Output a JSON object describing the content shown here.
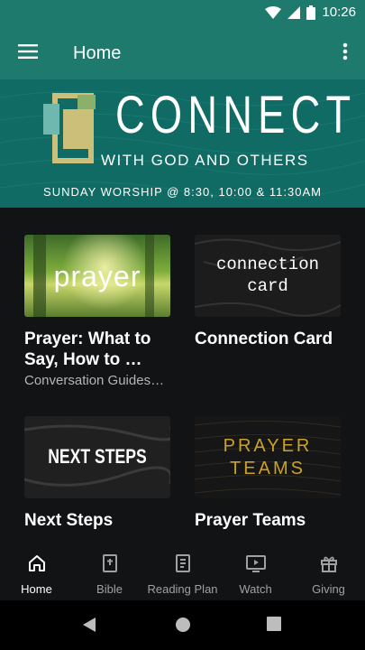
{
  "status_bar": {
    "time": "10:26"
  },
  "app_bar": {
    "title": "Home"
  },
  "banner": {
    "title": "CONNECT",
    "subtitle": "WITH GOD AND OTHERS",
    "times": "SUNDAY WORSHIP @ 8:30, 10:00 & 11:30AM"
  },
  "cards": [
    {
      "title": "Prayer: What to Say, How to …",
      "subtitle": "Conversation Guides…",
      "thumb_text": "prayer"
    },
    {
      "title": "Connection Card",
      "thumb_text_1": "connection",
      "thumb_text_2": "card"
    },
    {
      "title": "Next Steps",
      "thumb_text": "NEXT STEPS"
    },
    {
      "title": "Prayer Teams",
      "thumb_text_1": "PRAYER",
      "thumb_text_2": "TEAMS"
    }
  ],
  "bottom_nav": [
    {
      "label": "Home",
      "icon": "home-icon",
      "active": true
    },
    {
      "label": "Bible",
      "icon": "bible-icon"
    },
    {
      "label": "Reading Plan",
      "icon": "reading-plan-icon"
    },
    {
      "label": "Watch",
      "icon": "watch-icon"
    },
    {
      "label": "Giving",
      "icon": "gift-icon"
    }
  ],
  "colors": {
    "primary": "#1f7a6e",
    "banner_bg": "#0f6b63",
    "background": "#121314",
    "gold": "#c9a227"
  }
}
